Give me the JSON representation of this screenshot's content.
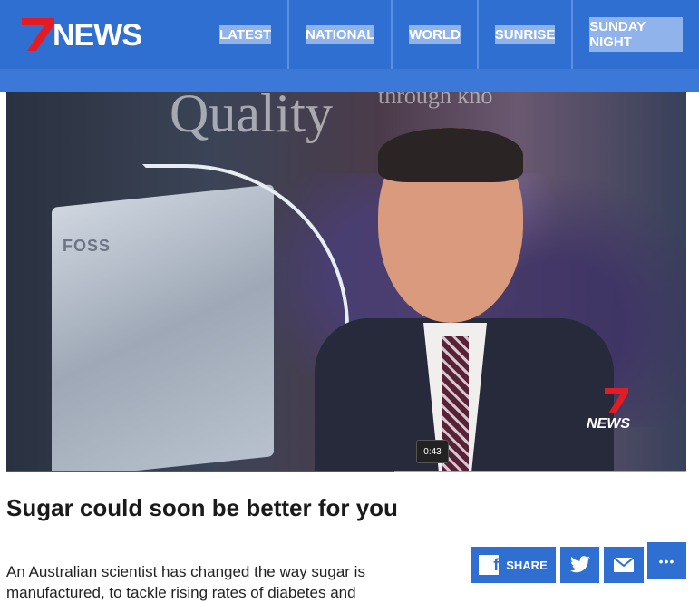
{
  "header": {
    "logo_text": "NEWS",
    "nav": [
      {
        "label": "LATEST"
      },
      {
        "label": "NATIONAL"
      },
      {
        "label": "WORLD"
      },
      {
        "label": "SUNRISE"
      },
      {
        "label": "SUNDAY NIGHT"
      }
    ]
  },
  "video": {
    "background_text": "Quality",
    "background_text_2": "through kno",
    "device_label": "FOSS",
    "watermark_text": "NEWS",
    "time_tooltip": "0:43",
    "progress_fraction": 0.57
  },
  "article": {
    "headline": "Sugar could soon be better for you",
    "body": "An Australian scientist has changed the way sugar is manufactured, to tackle rising rates of diabetes and"
  },
  "share": {
    "share_label": "SHARE",
    "more_label": "•••"
  },
  "colors": {
    "brand_blue": "#2f6fd1",
    "brand_red": "#e41b23"
  }
}
